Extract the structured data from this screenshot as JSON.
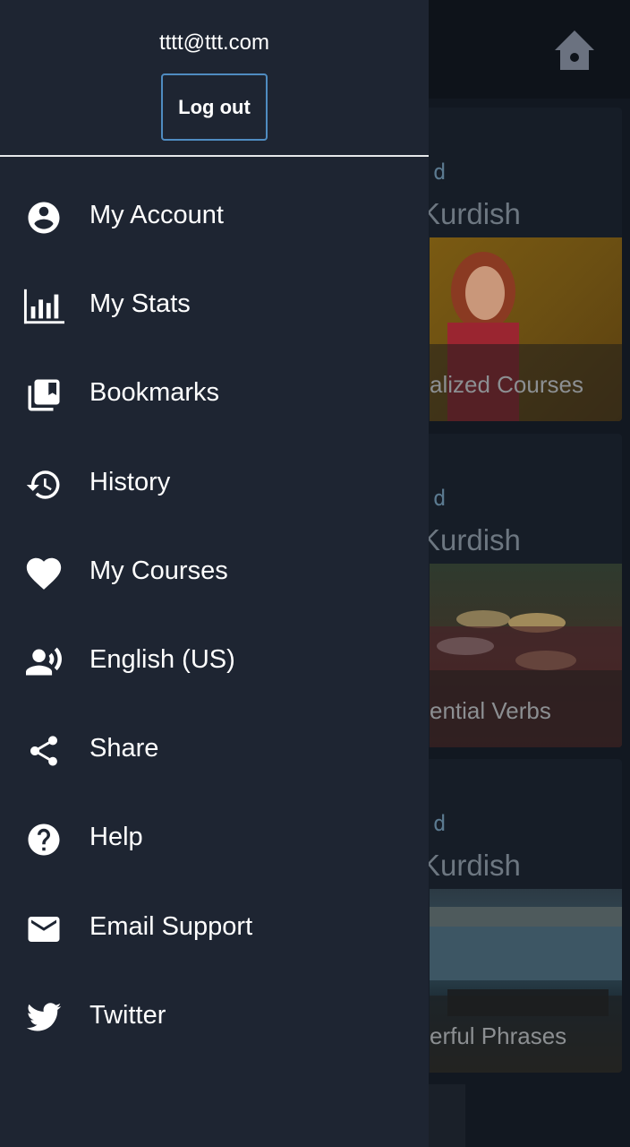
{
  "drawer": {
    "email": "tttt@ttt.com",
    "logout_label": "Log out",
    "items": [
      {
        "label": "My Account",
        "icon": "account-circle-icon"
      },
      {
        "label": "My Stats",
        "icon": "bar-chart-icon"
      },
      {
        "label": "Bookmarks",
        "icon": "bookmarks-icon"
      },
      {
        "label": "History",
        "icon": "history-icon"
      },
      {
        "label": "My Courses",
        "icon": "heart-icon"
      },
      {
        "label": "English (US)",
        "icon": "voice-icon"
      },
      {
        "label": "Share",
        "icon": "share-icon"
      },
      {
        "label": "Help",
        "icon": "help-icon"
      },
      {
        "label": "Email Support",
        "icon": "mail-icon"
      },
      {
        "label": "Twitter",
        "icon": "twitter-icon"
      }
    ]
  },
  "background": {
    "home_icon": "home-icon",
    "cards": [
      {
        "level": "d",
        "language": "Kurdish",
        "caption": "alized Courses"
      },
      {
        "level": "d",
        "language": "Kurdish",
        "caption": "ential Verbs"
      },
      {
        "level": "d",
        "language": "Kurdish",
        "caption": "erful Phrases"
      }
    ]
  },
  "colors": {
    "drawer_bg": "#1e2532",
    "accent_border": "#4f8cc1",
    "text": "#ffffff"
  }
}
